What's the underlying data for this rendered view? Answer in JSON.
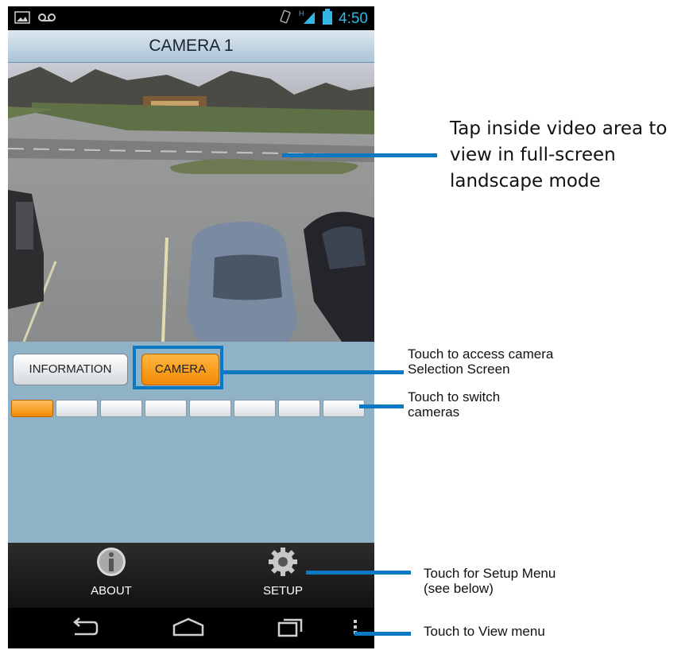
{
  "status_bar": {
    "time": "4:50",
    "left_icons": [
      "image-icon",
      "voicemail-icon"
    ],
    "right_icons": [
      "vibrate-icon",
      "signal-icon",
      "battery-icon"
    ]
  },
  "title": "CAMERA 1",
  "buttons": {
    "information": "INFORMATION",
    "camera": "CAMERA"
  },
  "channels": {
    "count": 8,
    "active_index": 0
  },
  "toolbar": {
    "about_label": "ABOUT",
    "setup_label": "SETUP"
  },
  "navbar": [
    "back-icon",
    "home-icon",
    "recent-apps-icon",
    "overflow-menu-icon"
  ],
  "annotations": {
    "video": [
      "Tap inside video area to",
      "view in full-screen",
      "landscape mode"
    ],
    "camera": [
      "Touch to access camera",
      "Selection Screen"
    ],
    "channels": [
      "Touch to switch",
      "cameras"
    ],
    "setup": [
      "Touch for Setup Menu",
      "(see below)"
    ],
    "menu": [
      "Touch to View menu"
    ]
  },
  "colors": {
    "accent_blue": "#0a78c2",
    "active_orange": "#f28a06",
    "panel_bg": "#8fb2c7",
    "status_blue": "#33b5e5"
  }
}
